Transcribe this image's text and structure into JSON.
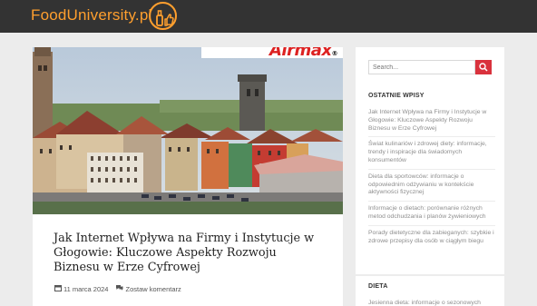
{
  "header": {
    "brand": "FoodUniversity.pl",
    "logo_icon": "bottle-thumbs-up-icon",
    "accent": "#ff9f2e"
  },
  "article": {
    "image_alt": "Panorama miasta z wieżami i kolorowymi kamienicami",
    "ad_text_black": "Air",
    "ad_text_red": "max",
    "ad_reg": "®",
    "title": "Jak Internet Wpływa na Firmy i Instytucje w Głogowie: Kluczowe Aspekty Rozwoju Biznesu w Erze Cyfrowej",
    "date": "11 marca 2024",
    "comment": "Zostaw komentarz",
    "date_icon": "calendar-icon",
    "comment_icon": "comments-icon"
  },
  "sidebar": {
    "search_placeholder": "Search...",
    "search_icon": "search-icon",
    "recent_heading": "OSTATNIE WPISY",
    "recent_posts": [
      "Jak Internet Wpływa na Firmy i Instytucje w Głogowie: Kluczowe Aspekty Rozwoju Biznesu w Erze Cyfrowej",
      "Świat kulinariów i zdrowej diety: informacje, trendy i inspiracje dla świadomych konsumentów",
      "Dieta dla sportowców: informacje o odpowiednim odżywianiu w kontekście aktywności fizycznej",
      "Informacje o dietach: porównanie różnych metod odchudzania i planów żywieniowych",
      "Porady dietetyczne dla zabieganych: szybkie i zdrowe przepisy dla osób w ciągłym biegu"
    ],
    "section2_heading": "DIETA",
    "section2_item": "Jesienna dieta: informacje o sezonowych"
  },
  "colors": {
    "topbar": "#333333",
    "search_button": "#d9323d",
    "link": "#8e8e8e"
  }
}
